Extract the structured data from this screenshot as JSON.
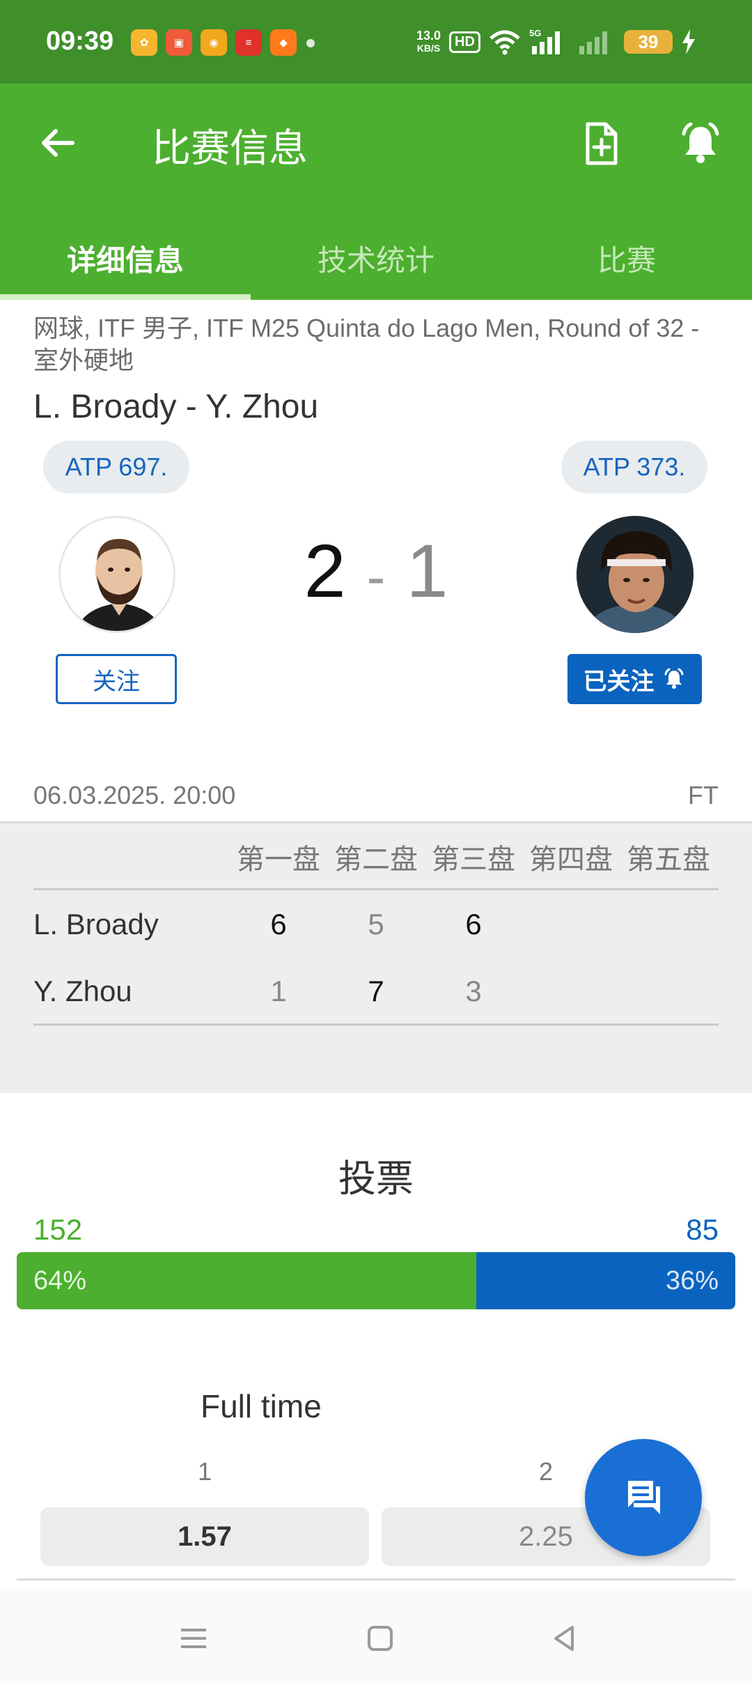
{
  "status_bar": {
    "time": "09:39",
    "net_speed_value": "13.0",
    "net_speed_unit": "KB/S",
    "network_type": "5G",
    "battery": "39",
    "hd_label": "HD"
  },
  "header": {
    "title": "比赛信息",
    "tabs": [
      {
        "label": "详细信息",
        "active": true
      },
      {
        "label": "技术统计",
        "active": false
      },
      {
        "label": "比赛",
        "active": false
      }
    ]
  },
  "match": {
    "meta": "网球, ITF 男子, ITF M25 Quinta do Lago Men, Round of 32 - 室外硬地",
    "name": "L. Broady - Y. Zhou",
    "home_rank": "ATP 697.",
    "away_rank": "ATP 373.",
    "home_score": "2",
    "separator": "-",
    "away_score": "1",
    "home_follow": "关注",
    "away_follow": "已关注",
    "datetime": "06.03.2025. 20:00",
    "status": "FT"
  },
  "sets": {
    "headers": [
      "第一盘",
      "第二盘",
      "第三盘",
      "第四盘",
      "第五盘"
    ],
    "rows": [
      {
        "player": "L. Broady",
        "scores": [
          "6",
          "5",
          "6"
        ],
        "won": [
          true,
          false,
          true
        ]
      },
      {
        "player": "Y. Zhou",
        "scores": [
          "1",
          "7",
          "3"
        ],
        "won": [
          false,
          true,
          false
        ]
      }
    ]
  },
  "vote": {
    "title": "投票",
    "home_count": "152",
    "away_count": "85",
    "home_percent": "64%",
    "away_percent": "36%",
    "home_fraction": 0.64
  },
  "odds": {
    "title": "Full time",
    "home_label": "1",
    "away_label": "2",
    "home_value": "1.57",
    "away_value": "2.25"
  },
  "colors": {
    "status_bar": "#3f8f2b",
    "header": "#4caf2f",
    "accent_blue": "#0a63be",
    "accent_green": "#4caf2f"
  }
}
